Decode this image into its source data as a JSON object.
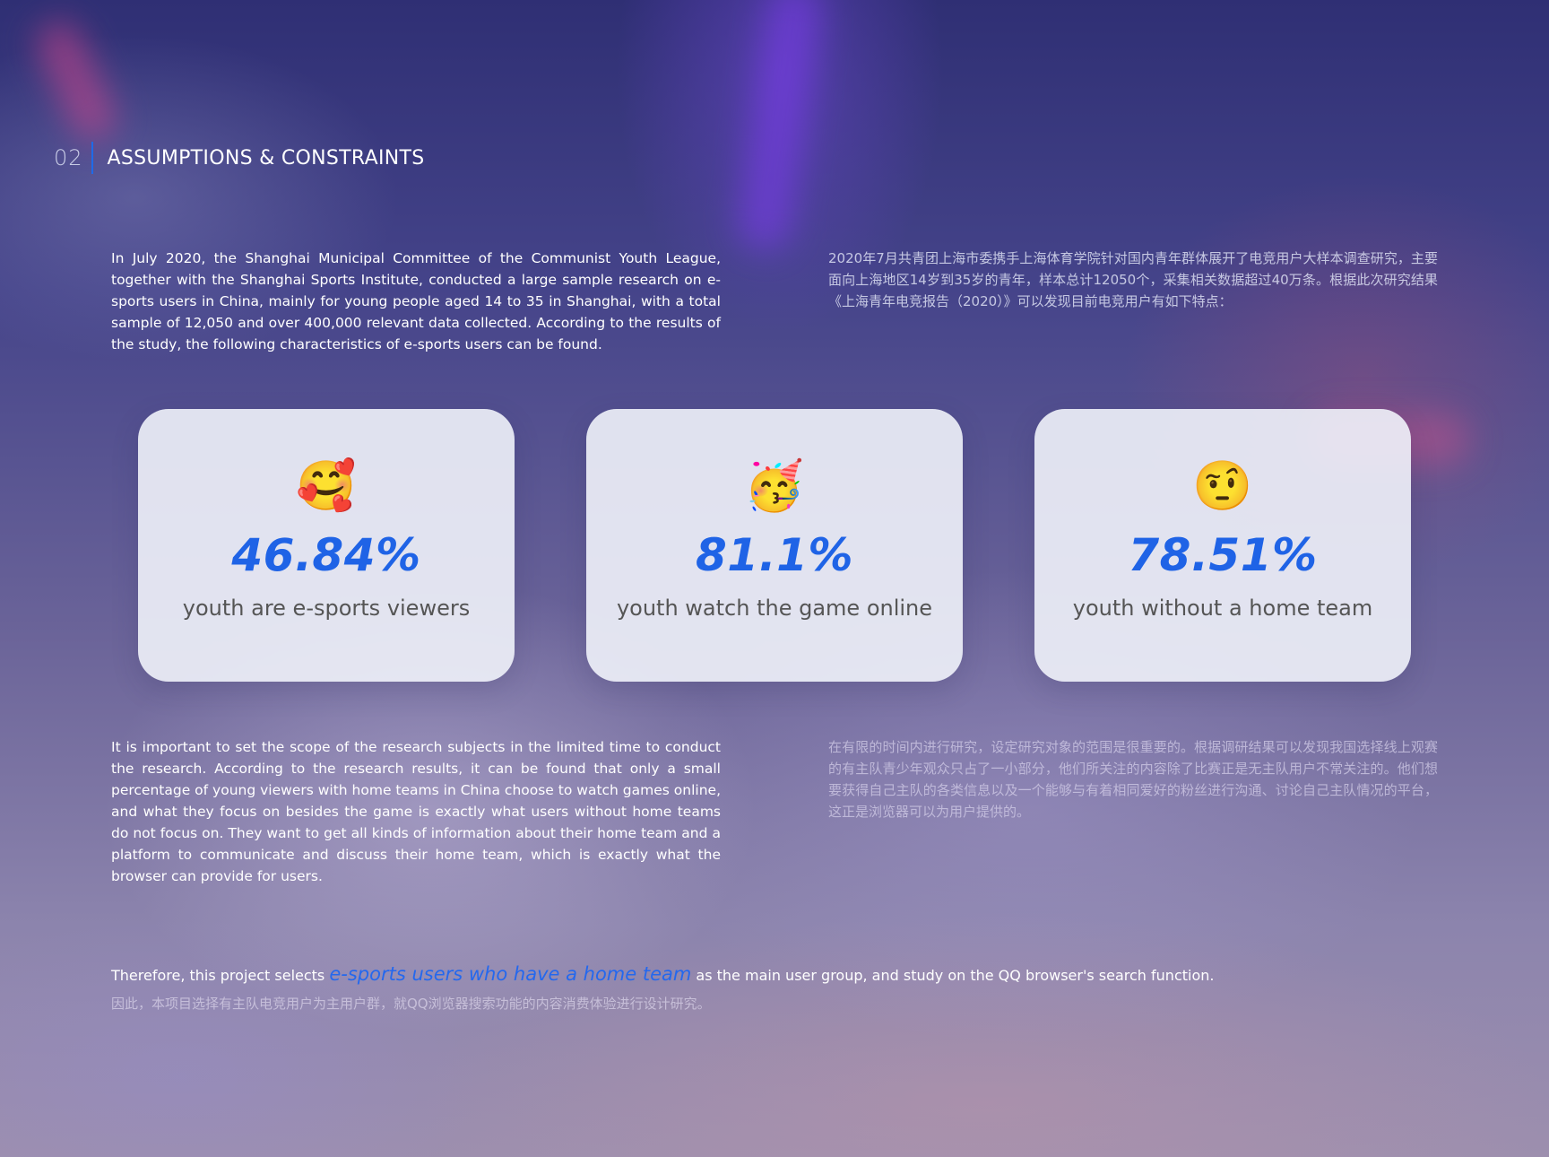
{
  "header": {
    "number": "02",
    "title": "ASSUMPTIONS & CONSTRAINTS"
  },
  "intro": {
    "en": "In July 2020, the Shanghai Municipal Committee of the Communist Youth League, together with the Shanghai Sports Institute, conducted a large sample research on e-sports users in China, mainly for young people aged 14 to 35 in Shanghai, with a total sample of 12,050 and over 400,000 relevant data collected. According to the results of the study, the following characteristics of e-sports users can be found.",
    "cn": "2020年7月共青团上海市委携手上海体育学院针对国内青年群体展开了电竞用户大样本调查研究，主要面向上海地区14岁到35岁的青年，样本总计12050个，采集相关数据超过40万条。根据此次研究结果《上海青年电竞报告（2020）》可以发现目前电竞用户有如下特点："
  },
  "stats": [
    {
      "icon": "smiling-face-with-hearts-icon",
      "emoji": "🥰",
      "value": "46.84%",
      "label": "youth are e-sports viewers"
    },
    {
      "icon": "partying-face-icon",
      "emoji": "🥳",
      "value": "81.1%",
      "label": "youth watch the game online"
    },
    {
      "icon": "face-with-raised-eyebrow-icon",
      "emoji": "🤨",
      "value": "78.51%",
      "label": "youth without a home team"
    }
  ],
  "scope": {
    "en": "It is important to set the scope of the research subjects in the limited time to conduct the research. According to the research results, it can be found that only a small percentage of young viewers with home teams in China choose to watch games online, and what they focus on besides the game is exactly what users without home teams do not  focus on. They want to get all kinds of information about their home team and a platform to communicate and discuss their home team, which is exactly what the browser can provide for users.",
    "cn": "在有限的时间内进行研究，设定研究对象的范围是很重要的。根据调研结果可以发现我国选择线上观赛的有主队青少年观众只占了一小部分，他们所关注的内容除了比赛正是无主队用户不常关注的。他们想要获得自己主队的各类信息以及一个能够与有着相同爱好的粉丝进行沟通、讨论自己主队情况的平台，这正是浏览器可以为用户提供的。"
  },
  "conclusion": {
    "prefix": "Therefore, this project selects ",
    "highlight": "e-sports users who have a home team",
    "suffix": " as the main user group, and study on the QQ browser's search function.",
    "cn": "因此，本项目选择有主队电竞用户为主用户群，就QQ浏览器搜索功能的内容消费体验进行设计研究。"
  },
  "colors": {
    "accent": "#1f63e6",
    "header_bar": "#1f6ae8"
  }
}
